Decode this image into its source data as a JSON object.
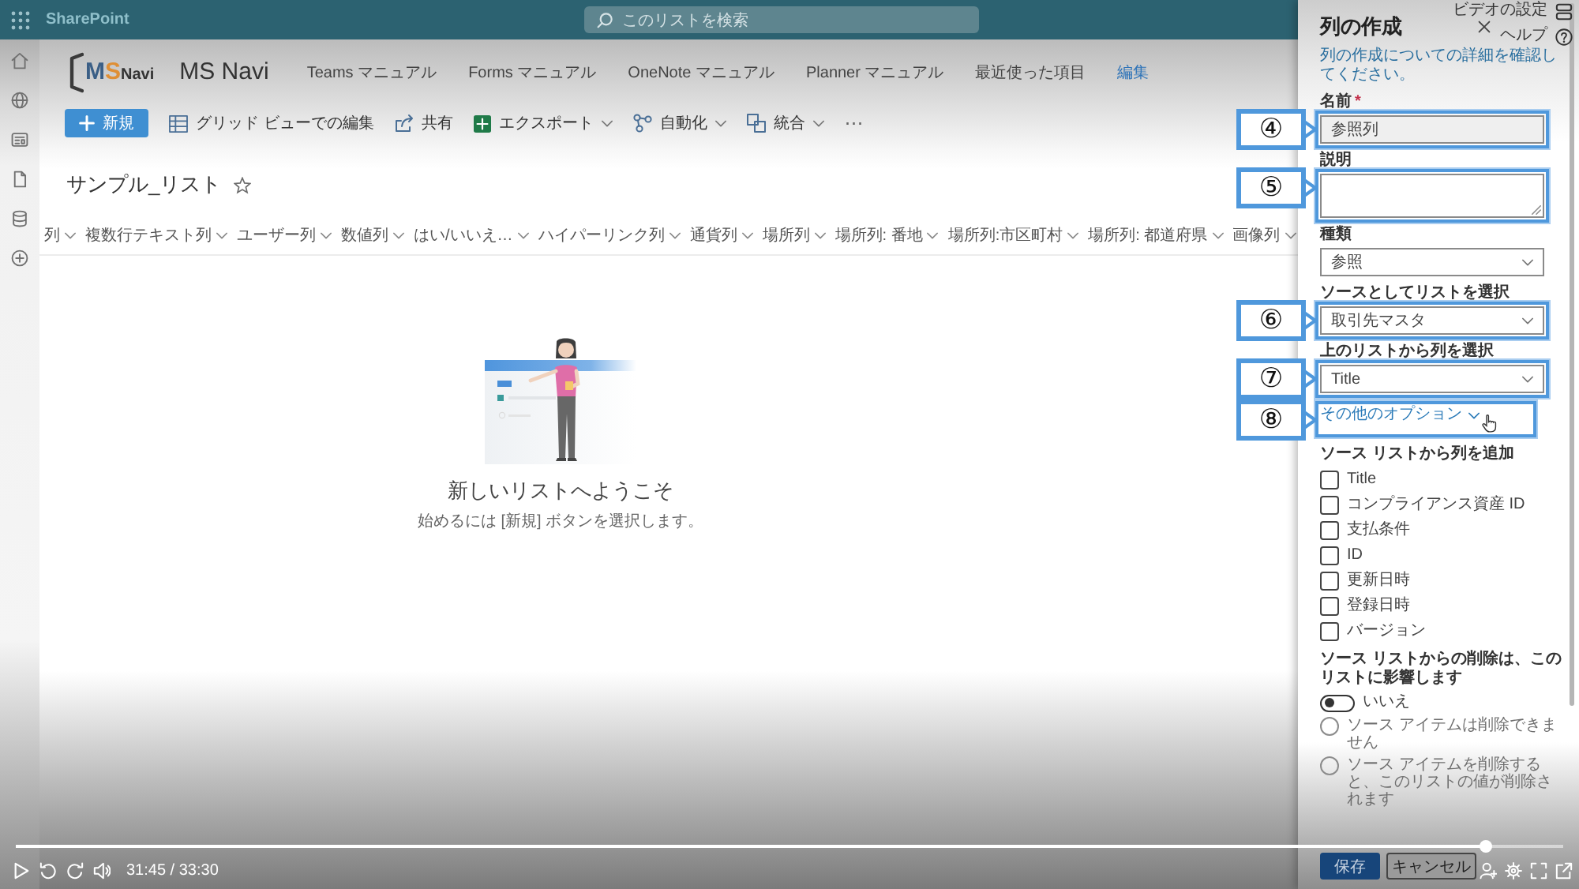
{
  "top_bar": {
    "app_name": "SharePoint",
    "search": {
      "placeholder": "このリストを検索"
    }
  },
  "site": {
    "logo": [
      "M",
      "S",
      "Navi"
    ],
    "title": "MS Navi",
    "nav": [
      {
        "label": "Teams マニュアル"
      },
      {
        "label": "Forms マニュアル"
      },
      {
        "label": "OneNote マニュアル"
      },
      {
        "label": "Planner マニュアル"
      },
      {
        "label": "最近使った項目"
      }
    ],
    "edit_link": "編集"
  },
  "command_bar": [
    {
      "kind": "primary",
      "label": "新規"
    },
    {
      "kind": "action",
      "label": "グリッド ビューでの編集"
    },
    {
      "kind": "action",
      "label": "共有"
    },
    {
      "kind": "menu",
      "label": "エクスポート"
    },
    {
      "kind": "menu",
      "label": "自動化"
    },
    {
      "kind": "menu",
      "label": "統合"
    },
    {
      "kind": "more",
      "label": "⋯"
    }
  ],
  "list": {
    "title": "サンプル_リスト",
    "favorite": false,
    "columns": [
      "列",
      "複数行テキスト列",
      "ユーザー列",
      "数値列",
      "はい/いいえ…",
      "ハイパーリンク列",
      "通貨列",
      "場所列",
      "場所列: 番地",
      "場所列:市区町村",
      "場所列: 都道府県",
      "画像列"
    ],
    "empty_state": {
      "title": "新しいリストへようこそ",
      "hint": "始めるには [新規] ボタンを選択します。"
    }
  },
  "panel": {
    "title": "列の作成",
    "description": "列の作成についての詳細を確認してください。",
    "fields": [
      {
        "kind": "text",
        "label": "名前",
        "required_mark": "*",
        "value": "参照列",
        "callout": "④"
      },
      {
        "kind": "textarea",
        "label": "説明",
        "callout": "⑤"
      },
      {
        "kind": "dropdown",
        "label": "種類",
        "value": "参照"
      },
      {
        "kind": "dropdown",
        "label": "ソースとしてリストを選択",
        "value": "取引先マスタ",
        "callout": "⑥"
      },
      {
        "kind": "dropdown",
        "label": "上のリストから列を選択",
        "value": "Title",
        "callout": "⑦"
      },
      {
        "kind": "link",
        "label": "その他のオプション",
        "callout": "⑧"
      }
    ],
    "additional_columns": {
      "label": "ソース リストから列を追加",
      "items": [
        {
          "label": "Title",
          "checked": false
        },
        {
          "label": "コンプライアンス資産 ID",
          "checked": false
        },
        {
          "label": "支払条件",
          "checked": false
        },
        {
          "label": "ID",
          "checked": false
        },
        {
          "label": "更新日時",
          "checked": false
        },
        {
          "label": "登録日時",
          "checked": false
        },
        {
          "label": "バージョン",
          "checked": false
        }
      ]
    },
    "delete_behavior": {
      "label": "ソース リストからの削除は、このリストに影響します",
      "toggle": {
        "label": "いいえ",
        "on": false
      },
      "options": [
        {
          "label": "ソース アイテムは削除できません",
          "selected": false,
          "disabled": true
        },
        {
          "label": "ソース アイテムを削除すると、このリストの値が削除されます",
          "selected": false,
          "disabled": true
        }
      ]
    },
    "buttons": [
      {
        "kind": "primary",
        "label": "保存"
      },
      {
        "kind": "secondary",
        "label": "キャンセル"
      }
    ]
  },
  "video_player": {
    "settings_label": "ビデオの設定",
    "help_label": "ヘルプ",
    "time": "31:45 / 33:30",
    "seek": {
      "level": 0.95
    }
  }
}
